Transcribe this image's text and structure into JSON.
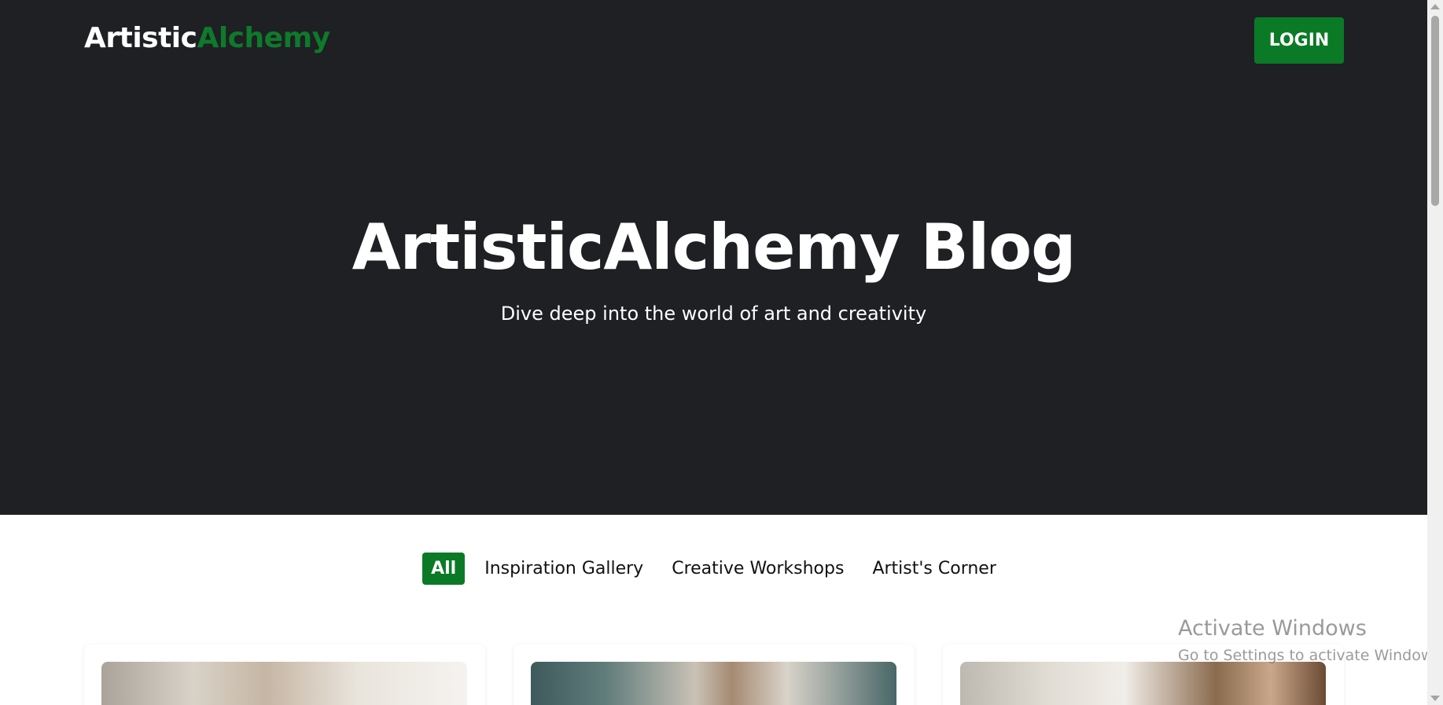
{
  "header": {
    "logo_part1": "Artistic",
    "logo_part2": "Alchemy",
    "login_label": "LOGIN"
  },
  "hero": {
    "title": "ArtisticAlchemy Blog",
    "subtitle": "Dive deep into the world of art and creativity"
  },
  "tabs": [
    {
      "label": "All",
      "active": true
    },
    {
      "label": "Inspiration Gallery",
      "active": false
    },
    {
      "label": "Creative Workshops",
      "active": false
    },
    {
      "label": "Artist's Corner",
      "active": false
    }
  ],
  "watermark": {
    "title": "Activate Windows",
    "subtitle": "Go to Settings to activate Windows."
  },
  "colors": {
    "hero_bg": "#1e2024",
    "accent": "#0b7a26",
    "text_light": "#ffffff"
  },
  "icons": [
    "scroll-up-arrow-icon",
    "scroll-down-arrow-icon"
  ]
}
